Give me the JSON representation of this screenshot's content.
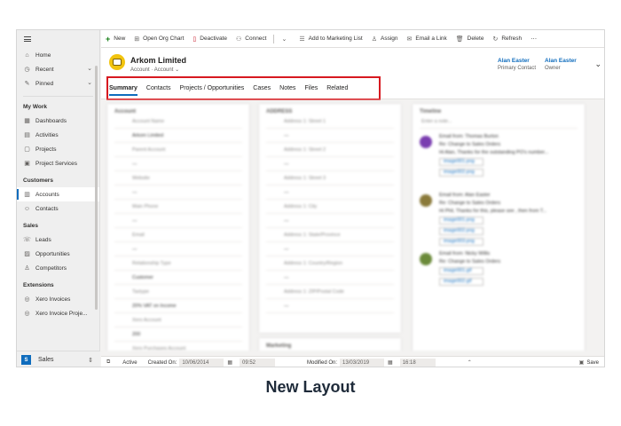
{
  "sidebar": {
    "top_items": [
      {
        "label": "Home",
        "icon": "home-icon"
      },
      {
        "label": "Recent",
        "icon": "clock-icon"
      },
      {
        "label": "Pinned",
        "icon": "pin-icon"
      }
    ],
    "groups": [
      {
        "title": "My Work",
        "items": [
          "Dashboards",
          "Activities",
          "Projects",
          "Project Services"
        ]
      },
      {
        "title": "Customers",
        "items": [
          "Accounts",
          "Contacts"
        ]
      },
      {
        "title": "Sales",
        "items": [
          "Leads",
          "Opportunities",
          "Competitors"
        ]
      },
      {
        "title": "Extensions",
        "items": [
          "Xero Invoices",
          "Xero Invoice Proje..."
        ]
      }
    ],
    "area_badge": "S",
    "area_label": "Sales",
    "active_item": "Accounts"
  },
  "commands": [
    {
      "label": "New",
      "icon": "plus-icon"
    },
    {
      "label": "Open Org Chart",
      "icon": "org-chart-icon"
    },
    {
      "label": "Deactivate",
      "icon": "deactivate-icon"
    },
    {
      "label": "Connect",
      "icon": "connect-icon"
    },
    {
      "label": "Add to Marketing List",
      "icon": "marketing-list-icon"
    },
    {
      "label": "Assign",
      "icon": "assign-icon"
    },
    {
      "label": "Email a Link",
      "icon": "email-icon"
    },
    {
      "label": "Delete",
      "icon": "delete-icon"
    },
    {
      "label": "Refresh",
      "icon": "refresh-icon"
    }
  ],
  "record": {
    "title": "Arkom Limited",
    "entity": "Account",
    "form": "Account",
    "primary_contact": {
      "name": "Alan Easter",
      "role": "Primary Contact"
    },
    "owner": {
      "name": "Alan Easter",
      "role": "Owner"
    }
  },
  "tabs": [
    "Summary",
    "Contacts",
    "Projects / Opportunities",
    "Cases",
    "Notes",
    "Files",
    "Related"
  ],
  "active_tab": "Summary",
  "content": {
    "account_title": "Account",
    "account_fields": [
      {
        "label": "Account Name",
        "value": "Arkom Limited"
      },
      {
        "label": "Parent Account",
        "value": "---"
      },
      {
        "label": "Website",
        "value": "---"
      },
      {
        "label": "Main Phone",
        "value": "---"
      },
      {
        "label": "Email",
        "value": "---"
      },
      {
        "label": "Relationship Type",
        "value": "Customer"
      },
      {
        "label": "Taxtype",
        "value": "20% VAT on Income"
      },
      {
        "label": "Xero Account",
        "value": "200"
      },
      {
        "label": "Xero Purchases Account",
        "value": ""
      }
    ],
    "address_title": "ADDRESS",
    "address_fields": [
      {
        "label": "Address 1: Street 1",
        "value": "---"
      },
      {
        "label": "Address 1: Street 2",
        "value": "---"
      },
      {
        "label": "Address 1: Street 3",
        "value": "---"
      },
      {
        "label": "Address 1: City",
        "value": "---"
      },
      {
        "label": "Address 1: State/Province",
        "value": "---"
      },
      {
        "label": "Address 1: Country/Region",
        "value": "---"
      },
      {
        "label": "Address 1: ZIP/Postal Code",
        "value": "---"
      }
    ],
    "marketing_title": "Marketing",
    "timeline_title": "Timeline",
    "timeline_placeholder": "Enter a note...",
    "timeline_items": [
      {
        "line1": "Email from: Thomas Burton",
        "line2": "Re: Change to Sales Orders",
        "line3": "Hi Alan, Thanks for the outstanding PO's number...",
        "time": "4:36 PM",
        "attachments": [
          "image001.png",
          "image002.png"
        ],
        "color": "#7a3db0"
      },
      {
        "line1": "Email from: Alan Easter",
        "line2": "Re: Change to Sales Orders",
        "line3": "Hi Phil, Thanks for this, please see , then from T...",
        "time": "1:04 PM",
        "attachments": [
          "image001.png",
          "image002.png",
          "image003.png"
        ],
        "color": "#8a7a3a"
      },
      {
        "line1": "Email from: Nicky Willis",
        "line2": "Re: Change to Sales Orders",
        "line3": "",
        "time": "01/03/2019",
        "attachments": [
          "image001.gif",
          "image002.gif"
        ],
        "color": "#6b8a3a"
      }
    ]
  },
  "footer": {
    "status": "Active",
    "created_label": "Created On:",
    "created_date": "10/06/2014",
    "created_time": "09:52",
    "modified_label": "Modified On:",
    "modified_date": "13/03/2019",
    "modified_time": "16:18",
    "save_label": "Save"
  },
  "caption": "New Layout",
  "colors": {
    "accent": "#0f6cbd",
    "highlight": "#d71920"
  }
}
